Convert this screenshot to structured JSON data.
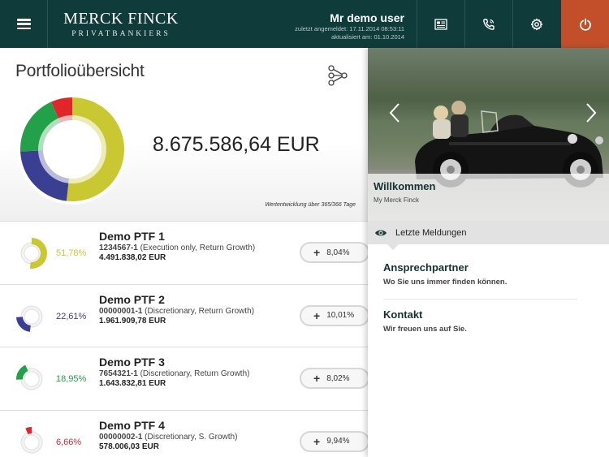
{
  "header": {
    "logo_line1": "MERCK FINCK",
    "logo_line2": "PRIVATBANKIERS",
    "user_name": "Mr demo user",
    "last_login": "zuletzt angemeldet: 17.11.2014 08:53:11",
    "updated": "aktualisiert am: 01.10.2014",
    "icons": [
      "menu-icon",
      "document-icon",
      "phone-icon",
      "gear-icon",
      "power-icon"
    ],
    "logout_color": "#c24f2a",
    "bar_color": "#0f3b3a"
  },
  "overview": {
    "title": "Portfolioübersicht",
    "total": "8.675.586,64 EUR",
    "performance_note": "Wertentwicklung über 365/366 Tage",
    "allocation": [
      {
        "color": "#c9c832",
        "percent": 51.78
      },
      {
        "color": "#3b3f93",
        "percent": 22.61
      },
      {
        "color": "#22a14a",
        "percent": 18.95
      },
      {
        "color": "#e0262b",
        "percent": 6.66
      }
    ]
  },
  "portfolios": [
    {
      "name": "Demo PTF 1",
      "account": "1234567-1",
      "details": " (Execution only, Return Growth)",
      "value": "4.491.838,02 EUR",
      "percent": "51,78%",
      "share": 51.78,
      "color": "#c9c832",
      "start": 0,
      "performance": "8,04%"
    },
    {
      "name": "Demo PTF 2",
      "account": "00000001-1",
      "details": " (Discretionary, Return Growth)",
      "value": "1.961.909,78 EUR",
      "percent": "22,61%",
      "share": 22.61,
      "color": "#3b3f93",
      "start": 51.78,
      "performance": "10,01%"
    },
    {
      "name": "Demo PTF 3",
      "account": "7654321-1",
      "details": " (Discretionary, Return Growth)",
      "value": "1.643.832,81 EUR",
      "percent": "18,95%",
      "share": 18.95,
      "color": "#22a14a",
      "start": 74.39,
      "performance": "8,02%"
    },
    {
      "name": "Demo PTF 4",
      "account": "00000002-1",
      "details": " (Discretionary, S. Growth)",
      "value": "578.006,03 EUR",
      "percent": "6,66%",
      "share": 6.66,
      "color": "#e0262b",
      "start": 93.34,
      "performance": "9,94%"
    }
  ],
  "perf_prefix": "+",
  "right": {
    "hero_title": "Willkommen",
    "hero_subtitle": "My Merck Finck",
    "news_label": "Letzte Meldungen",
    "items": [
      {
        "title": "Ansprechpartner",
        "subtitle": "Wo Sie uns immer finden können."
      },
      {
        "title": "Kontakt",
        "subtitle": "Wir freuen uns auf Sie."
      }
    ]
  }
}
